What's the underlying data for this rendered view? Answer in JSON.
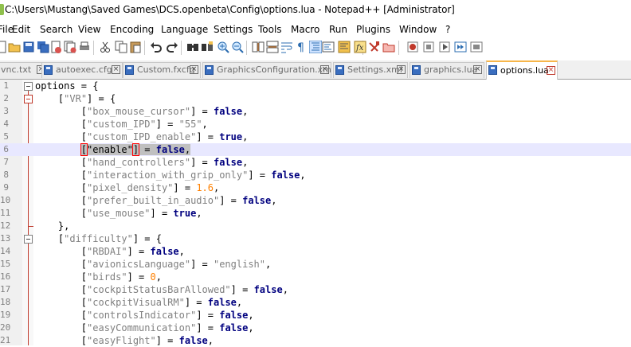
{
  "window": {
    "title": "C:\\Users\\Mustang\\Saved Games\\DCS.openbeta\\Config\\options.lua - Notepad++ [Administrator]"
  },
  "menu": [
    "File",
    "Edit",
    "Search",
    "View",
    "Encoding",
    "Language",
    "Settings",
    "Tools",
    "Macro",
    "Run",
    "Plugins",
    "Window",
    "?"
  ],
  "toolbar": {
    "buttons": [
      "new-file",
      "open-file",
      "save-file",
      "save-all",
      "close-file",
      "close-all",
      "print",
      "cut",
      "copy",
      "paste",
      "undo",
      "redo",
      "find",
      "replace",
      "zoom-in",
      "zoom-out",
      "sync-vertical",
      "sync-horizontal",
      "word-wrap",
      "show-all-chars",
      "indent-guide",
      "user-language",
      "doc-map",
      "function-list",
      "folder-workspace",
      "monitoring",
      "record-macro",
      "stop-record",
      "play-macro",
      "run-macro-multiple",
      "save-macro"
    ]
  },
  "tabs": [
    {
      "label": "vnc.txt",
      "active": false
    },
    {
      "label": "autoexec.cfg",
      "active": false
    },
    {
      "label": "Custom.fxcfg",
      "active": false
    },
    {
      "label": "GraphicsConfiguration.xml",
      "active": false
    },
    {
      "label": "Settings.xml",
      "active": false
    },
    {
      "label": "graphics.lua",
      "active": false
    },
    {
      "label": "options.lua",
      "active": true
    }
  ],
  "editor": {
    "current_line": 6,
    "lines": [
      {
        "num": "1",
        "fold": "box",
        "indent": 0,
        "tokens": [
          [
            "t",
            "options"
          ],
          [
            "t",
            " = {"
          ]
        ]
      },
      {
        "num": "2",
        "fold": "box-red",
        "indent": 4,
        "tokens": [
          [
            "t",
            "["
          ],
          [
            "s",
            "\"VR\""
          ],
          [
            "t",
            "] = {"
          ]
        ]
      },
      {
        "num": "3",
        "fold": "",
        "indent": 8,
        "tokens": [
          [
            "t",
            "["
          ],
          [
            "s",
            "\"box_mouse_cursor\""
          ],
          [
            "t",
            "] = "
          ],
          [
            "k",
            "false"
          ],
          [
            "t",
            ","
          ]
        ]
      },
      {
        "num": "4",
        "fold": "",
        "indent": 8,
        "tokens": [
          [
            "t",
            "["
          ],
          [
            "s",
            "\"custom_IPD\""
          ],
          [
            "t",
            "] = "
          ],
          [
            "s",
            "\"55\""
          ],
          [
            "t",
            ","
          ]
        ]
      },
      {
        "num": "5",
        "fold": "",
        "indent": 8,
        "tokens": [
          [
            "t",
            "["
          ],
          [
            "s",
            "\"custom_IPD_enable\""
          ],
          [
            "t",
            "] = "
          ],
          [
            "k",
            "true"
          ],
          [
            "t",
            ","
          ]
        ]
      },
      {
        "num": "6",
        "fold": "",
        "indent": 8,
        "tokens": [
          [
            "b",
            "["
          ],
          [
            "h",
            "\"enable\""
          ],
          [
            "b",
            "]"
          ],
          [
            "h",
            " = "
          ],
          [
            "hk",
            "false"
          ],
          [
            "h",
            ","
          ]
        ]
      },
      {
        "num": "7",
        "fold": "",
        "indent": 8,
        "tokens": [
          [
            "t",
            "["
          ],
          [
            "s",
            "\"hand_controllers\""
          ],
          [
            "t",
            "] = "
          ],
          [
            "k",
            "false"
          ],
          [
            "t",
            ","
          ]
        ]
      },
      {
        "num": "8",
        "fold": "",
        "indent": 8,
        "tokens": [
          [
            "t",
            "["
          ],
          [
            "s",
            "\"interaction_with_grip_only\""
          ],
          [
            "t",
            "] = "
          ],
          [
            "k",
            "false"
          ],
          [
            "t",
            ","
          ]
        ]
      },
      {
        "num": "9",
        "fold": "",
        "indent": 8,
        "tokens": [
          [
            "t",
            "["
          ],
          [
            "s",
            "\"pixel_density\""
          ],
          [
            "t",
            "] = "
          ],
          [
            "n",
            "1.6"
          ],
          [
            "t",
            ","
          ]
        ]
      },
      {
        "num": "10",
        "fold": "",
        "indent": 8,
        "tokens": [
          [
            "t",
            "["
          ],
          [
            "s",
            "\"prefer_built_in_audio\""
          ],
          [
            "t",
            "] = "
          ],
          [
            "k",
            "false"
          ],
          [
            "t",
            ","
          ]
        ]
      },
      {
        "num": "11",
        "fold": "",
        "indent": 8,
        "tokens": [
          [
            "t",
            "["
          ],
          [
            "s",
            "\"use_mouse\""
          ],
          [
            "t",
            "] = "
          ],
          [
            "k",
            "true"
          ],
          [
            "t",
            ","
          ]
        ]
      },
      {
        "num": "12",
        "fold": "end",
        "indent": 4,
        "tokens": [
          [
            "t",
            "},"
          ]
        ]
      },
      {
        "num": "13",
        "fold": "box",
        "indent": 4,
        "tokens": [
          [
            "t",
            "["
          ],
          [
            "s",
            "\"difficulty\""
          ],
          [
            "t",
            "] = {"
          ]
        ]
      },
      {
        "num": "14",
        "fold": "",
        "indent": 8,
        "tokens": [
          [
            "t",
            "["
          ],
          [
            "s",
            "\"RBDAI\""
          ],
          [
            "t",
            "] = "
          ],
          [
            "k",
            "false"
          ],
          [
            "t",
            ","
          ]
        ]
      },
      {
        "num": "15",
        "fold": "",
        "indent": 8,
        "tokens": [
          [
            "t",
            "["
          ],
          [
            "s",
            "\"avionicsLanguage\""
          ],
          [
            "t",
            "] = "
          ],
          [
            "s",
            "\"english\""
          ],
          [
            "t",
            ","
          ]
        ]
      },
      {
        "num": "16",
        "fold": "",
        "indent": 8,
        "tokens": [
          [
            "t",
            "["
          ],
          [
            "s",
            "\"birds\""
          ],
          [
            "t",
            "] = "
          ],
          [
            "n",
            "0"
          ],
          [
            "t",
            ","
          ]
        ]
      },
      {
        "num": "17",
        "fold": "",
        "indent": 8,
        "tokens": [
          [
            "t",
            "["
          ],
          [
            "s",
            "\"cockpitStatusBarAllowed\""
          ],
          [
            "t",
            "] = "
          ],
          [
            "k",
            "false"
          ],
          [
            "t",
            ","
          ]
        ]
      },
      {
        "num": "18",
        "fold": "",
        "indent": 8,
        "tokens": [
          [
            "t",
            "["
          ],
          [
            "s",
            "\"cockpitVisualRM\""
          ],
          [
            "t",
            "] = "
          ],
          [
            "k",
            "false"
          ],
          [
            "t",
            ","
          ]
        ]
      },
      {
        "num": "19",
        "fold": "",
        "indent": 8,
        "tokens": [
          [
            "t",
            "["
          ],
          [
            "s",
            "\"controlsIndicator\""
          ],
          [
            "t",
            "] = "
          ],
          [
            "k",
            "false"
          ],
          [
            "t",
            ","
          ]
        ]
      },
      {
        "num": "20",
        "fold": "",
        "indent": 8,
        "tokens": [
          [
            "t",
            "["
          ],
          [
            "s",
            "\"easyCommunication\""
          ],
          [
            "t",
            "] = "
          ],
          [
            "k",
            "false"
          ],
          [
            "t",
            ","
          ]
        ]
      },
      {
        "num": "21",
        "fold": "",
        "indent": 8,
        "tokens": [
          [
            "t",
            "["
          ],
          [
            "s",
            "\"easyFlight\""
          ],
          [
            "t",
            "] = "
          ],
          [
            "k",
            "false"
          ],
          [
            "t",
            ","
          ]
        ]
      }
    ]
  }
}
